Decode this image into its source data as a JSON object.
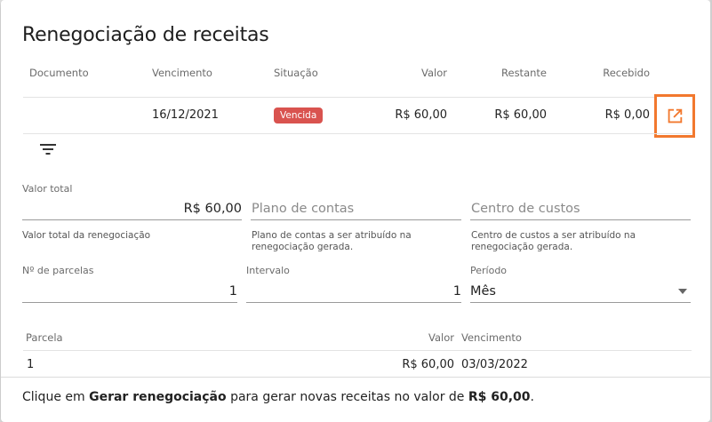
{
  "dialog": {
    "title": "Renegociação de receitas"
  },
  "table": {
    "headers": {
      "documento": "Documento",
      "vencimento": "Vencimento",
      "situacao": "Situação",
      "valor": "Valor",
      "restante": "Restante",
      "recebido": "Recebido"
    },
    "row": {
      "documento": "",
      "vencimento": "16/12/2021",
      "situacao": "Vencida",
      "valor": "R$ 60,00",
      "restante": "R$ 60,00",
      "recebido": "R$ 0,00"
    },
    "open_icon": "open-in-new-icon",
    "status_color": "#d9534f"
  },
  "filter": {
    "icon": "filter-icon"
  },
  "form": {
    "valor_total": {
      "label": "Valor total",
      "value": "R$ 60,00",
      "hint": "Valor total da renegociação"
    },
    "plano_contas": {
      "placeholder": "Plano de contas",
      "hint_line1": "Plano de contas a ser atribuído na",
      "hint_line2": "renegociação gerada."
    },
    "centro_custos": {
      "placeholder": "Centro de custos",
      "hint_line1": "Centro de custos a ser atribuído na",
      "hint_line2": "renegociação gerada."
    },
    "parcelas": {
      "label": "Nº de parcelas",
      "value": "1"
    },
    "intervalo": {
      "label": "Intervalo",
      "value": "1"
    },
    "periodo": {
      "label": "Período",
      "value": "Mês"
    }
  },
  "installments": {
    "headers": {
      "parcela": "Parcela",
      "valor": "Valor",
      "vencimento": "Vencimento"
    },
    "rows": [
      {
        "parcela": "1",
        "valor": "R$ 60,00",
        "vencimento": "03/03/2022"
      }
    ]
  },
  "footer": {
    "prefix": "Clique em ",
    "action": "Gerar renegociação",
    "middle": " para gerar novas receitas no valor de ",
    "amount": "R$ 60,00",
    "suffix": "."
  },
  "colors": {
    "accent_highlight": "#f2782e"
  }
}
